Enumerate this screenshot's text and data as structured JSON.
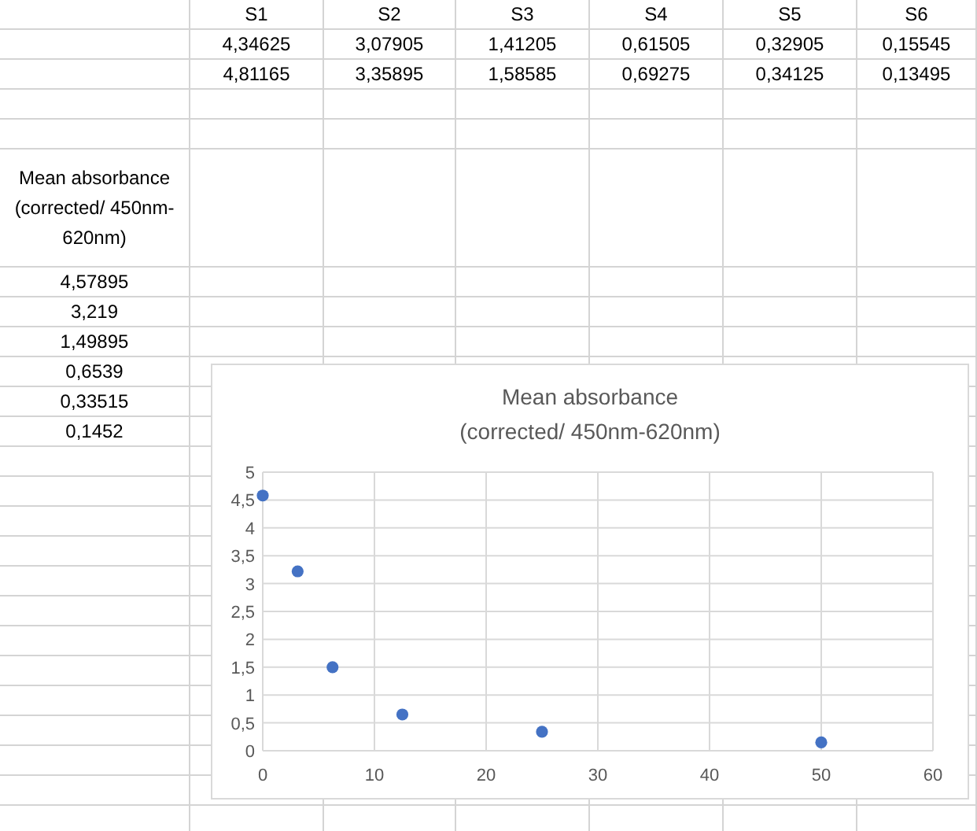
{
  "sheet": {
    "header_row": [
      "S1",
      "S2",
      "S3",
      "S4",
      "S5",
      "S6"
    ],
    "rows": [
      [
        "4,34625",
        "3,07905",
        "1,41205",
        "0,61505",
        "0,32905",
        "0,15545"
      ],
      [
        "4,81165",
        "3,35895",
        "1,58585",
        "0,69275",
        "0,34125",
        "0,13495"
      ]
    ],
    "mean_label": "Mean absorbance (corrected/ 450nm-620nm)",
    "means": [
      "4,57895",
      "3,219",
      "1,49895",
      "0,6539",
      "0,33515",
      "0,1452"
    ]
  },
  "chart": {
    "chart_data": {
      "type": "scatter",
      "title": "Mean absorbance (corrected/ 450nm-620nm)",
      "x": [
        0,
        3.125,
        6.25,
        12.5,
        25,
        50
      ],
      "series": [
        {
          "color": "#4472c4",
          "values": [
            4.58,
            3.22,
            1.5,
            0.65,
            0.34,
            0.15
          ]
        }
      ],
      "grid": true,
      "xlim": [
        0,
        60
      ],
      "ylim": [
        0,
        5
      ],
      "xticks": [
        0,
        10,
        20,
        30,
        40,
        50,
        60
      ],
      "yticks": [
        0,
        {
          "value": 0.5,
          "label": "0,5"
        },
        1,
        {
          "value": 1.5,
          "label": "1,5"
        },
        2,
        {
          "value": 2.5,
          "label": "2,5"
        },
        3,
        {
          "value": 3.5,
          "label": "3,5"
        },
        4,
        {
          "value": 4.5,
          "label": "4,5"
        },
        5
      ]
    }
  }
}
